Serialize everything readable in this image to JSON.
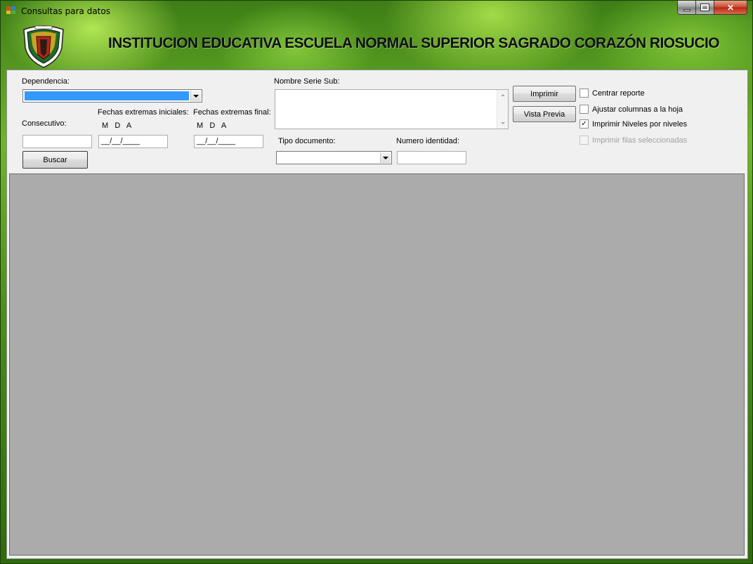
{
  "window": {
    "title": "Consultas para datos",
    "minimize_icon": "minimize-icon",
    "maximize_icon": "maximize-icon",
    "close_icon": "close-icon",
    "close_glyph": "✕"
  },
  "header": {
    "school_name": "INSTITUCION EDUCATIVA ESCUELA NORMAL SUPERIOR SAGRADO CORAZÓN RIOSUCIO",
    "crest_icon": "school-crest-icon"
  },
  "form": {
    "dependencia_label": "Dependencia:",
    "dependencia_value": "",
    "consecutivo_label": "Consecutivo:",
    "consecutivo_value": "",
    "fechas_iniciales_label": "Fechas extremas iniciales:",
    "fechas_finales_label": "Fechas extremas final:",
    "fecha_ini_headers": "M   D   A",
    "fecha_fin_headers": "M   D   A",
    "fecha_ini_value": "__/__/____",
    "fecha_fin_value": "__/__/____",
    "nombre_serie_label": "Nombre Serie Sub:",
    "nombre_serie_value": "",
    "tipo_documento_label": "Tipo documento:",
    "tipo_documento_value": "",
    "numero_identidad_label": "Numero identidad:",
    "numero_identidad_value": "",
    "buscar_label": "Buscar",
    "imprimir_label": "Imprimir",
    "vista_previa_label": "Vista Previa"
  },
  "options": {
    "centrar_reporte": {
      "label": "Centrar reporte",
      "checked": false,
      "enabled": true
    },
    "ajustar_columnas": {
      "label": "Ajustar columnas a la hoja",
      "checked": false,
      "enabled": true
    },
    "imprimir_niveles": {
      "label": "Imprimir Niveles por niveles",
      "checked": true,
      "enabled": true,
      "mark": "✓"
    },
    "imprimir_filas": {
      "label": "Imprimir filas seleccionadas",
      "checked": false,
      "enabled": false
    }
  },
  "colors": {
    "selection": "#3399ff",
    "grid_background": "#ababab",
    "panel_background": "#f0f0f0"
  }
}
